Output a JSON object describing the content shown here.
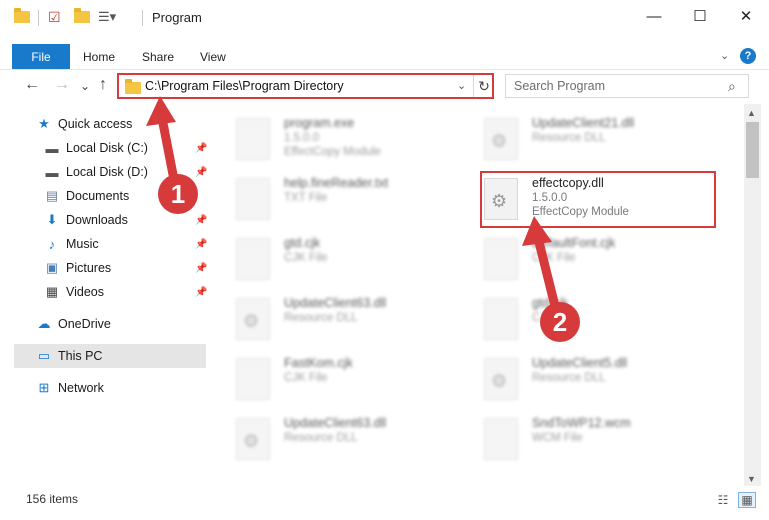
{
  "window": {
    "title": "Program",
    "minimize": "—",
    "maximize": "☐",
    "close": "✕"
  },
  "ribbon": {
    "tabs": [
      "File",
      "Home",
      "Share",
      "View"
    ],
    "help": "?",
    "accent_color": "#1979ca"
  },
  "nav": {
    "back": "←",
    "forward": "→",
    "recent": "⌄",
    "up": "↑",
    "address": "C:\\Program Files\\Program Directory",
    "search_placeholder": "Search Program"
  },
  "sidebar": {
    "items": [
      {
        "label": "Quick access",
        "icon": "star-icon",
        "pinned": false
      },
      {
        "label": "Local Disk (C:)",
        "icon": "drive-icon",
        "pinned": true
      },
      {
        "label": "Local Disk (D:)",
        "icon": "drive-icon",
        "pinned": true
      },
      {
        "label": "Documents",
        "icon": "documents-icon",
        "pinned": true
      },
      {
        "label": "Downloads",
        "icon": "download-icon",
        "pinned": true
      },
      {
        "label": "Music",
        "icon": "music-icon",
        "pinned": true
      },
      {
        "label": "Pictures",
        "icon": "pictures-icon",
        "pinned": true
      },
      {
        "label": "Videos",
        "icon": "videos-icon",
        "pinned": true
      },
      {
        "label": "OneDrive",
        "icon": "cloud-icon",
        "pinned": false
      },
      {
        "label": "This PC",
        "icon": "computer-icon",
        "pinned": false,
        "selected": true
      },
      {
        "label": "Network",
        "icon": "network-icon",
        "pinned": false
      }
    ]
  },
  "files": [
    {
      "name": "program.exe",
      "version": "1.5.0.0",
      "description": "EffectCopy Module"
    },
    {
      "name": "UpdateClient21.dll",
      "version": "Resource DLL",
      "description": ""
    },
    {
      "name": "help.fineReader.txt",
      "version": "TXT File",
      "description": ""
    },
    {
      "name": "effectcopy.dll",
      "version": "1.5.0.0",
      "description": "EffectCopy Module"
    },
    {
      "name": "gtd.cjk",
      "version": "CJK File",
      "description": ""
    },
    {
      "name": "DefaultFont.cjk",
      "version": "CJK File",
      "description": ""
    },
    {
      "name": "UpdateClient63.dll",
      "version": "Resource DLL",
      "description": ""
    },
    {
      "name": "gtd.cjk",
      "version": "CJK File",
      "description": ""
    },
    {
      "name": "FastKom.cjk",
      "version": "CJK File",
      "description": ""
    },
    {
      "name": "UpdateClient5.dll",
      "version": "Resource DLL",
      "description": ""
    },
    {
      "name": "UpdateClient63.dll",
      "version": "Resource DLL",
      "description": ""
    },
    {
      "name": "SndToWP12.wcm",
      "version": "WCM File",
      "description": ""
    }
  ],
  "status": {
    "item_count": "156 items"
  },
  "annotations": {
    "step1": "1",
    "step2": "2",
    "color": "#d63a3a"
  }
}
